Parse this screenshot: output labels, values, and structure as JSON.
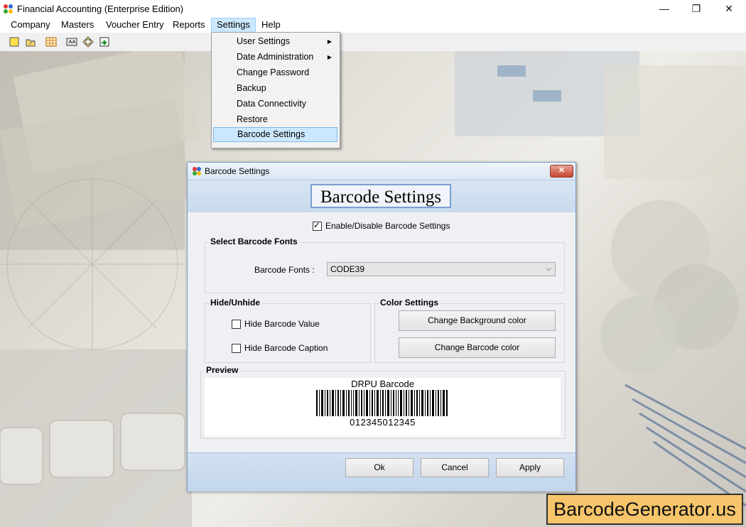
{
  "window": {
    "title": "Financial Accounting (Enterprise Edition)",
    "controls": {
      "minimize": "—",
      "maximize": "❐",
      "close": "✕"
    }
  },
  "menubar": {
    "items": [
      {
        "label": "Company",
        "mnemonic": "C"
      },
      {
        "label": "Masters",
        "mnemonic": "M"
      },
      {
        "label": "Voucher Entry",
        "mnemonic": "V"
      },
      {
        "label": "Reports",
        "mnemonic": "R"
      },
      {
        "label": "Settings",
        "mnemonic": "S"
      },
      {
        "label": "Help",
        "mnemonic": "H"
      }
    ]
  },
  "toolbar": {
    "icons": [
      "new-icon",
      "open-icon",
      "table-icon",
      "scale-icon",
      "ledger-icon",
      "export-icon"
    ]
  },
  "settings_menu": {
    "items": [
      {
        "label": "User Settings",
        "submenu": true
      },
      {
        "label": "Date Administration",
        "submenu": true
      },
      {
        "label": "Change Password",
        "submenu": false
      },
      {
        "label": "Backup",
        "submenu": false
      },
      {
        "label": "Data Connectivity",
        "submenu": false
      },
      {
        "label": "Restore",
        "submenu": false
      },
      {
        "label": "Barcode Settings",
        "submenu": false,
        "selected": true
      }
    ]
  },
  "dialog": {
    "title": "Barcode Settings",
    "close_label": "✕",
    "heading": "Barcode Settings",
    "enable_checkbox": {
      "label": "Enable/Disable Barcode Settings",
      "checked": true
    },
    "fonts_group": {
      "title": "Select Barcode Fonts",
      "field_label": "Barcode Fonts :",
      "selected": "CODE39"
    },
    "hide_group": {
      "title": "Hide/Unhide",
      "options": [
        {
          "label": "Hide Barcode Value",
          "checked": false
        },
        {
          "label": "Hide Barcode Caption",
          "checked": false
        }
      ]
    },
    "color_group": {
      "title": "Color Settings",
      "buttons": [
        "Change Background color",
        "Change Barcode color"
      ]
    },
    "preview": {
      "title": "Preview",
      "caption": "DRPU Barcode",
      "value": "012345012345"
    },
    "buttons": {
      "ok": "Ok",
      "cancel": "Cancel",
      "apply": "Apply"
    }
  },
  "watermark": "BarcodeGenerator.us",
  "colors": {
    "menu_highlight": "#cce8ff",
    "dialog_header": "#d0dff1",
    "watermark_bg": "#f7c56b"
  }
}
